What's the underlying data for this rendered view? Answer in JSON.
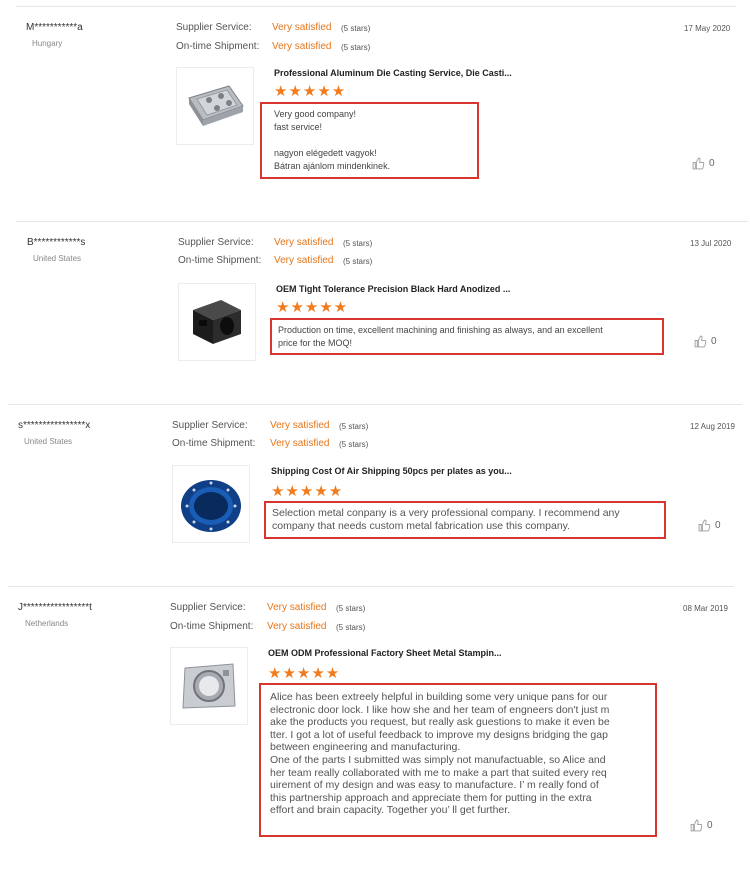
{
  "labels": {
    "supplier_service": "Supplier Service:",
    "ontime_shipment": "On-time Shipment:"
  },
  "colors": {
    "accent": "#e6761c",
    "star": "#f07c1d",
    "highlight_box": "#d9352f"
  },
  "reviews": [
    {
      "user": "M***********a",
      "country": "Hungary",
      "date": "17 May 2020",
      "supplier_value": "Very satisfied",
      "supplier_stars": "(5 stars)",
      "shipment_value": "Very satisfied",
      "shipment_stars": "(5 stars)",
      "product_title": "Professional Aluminum Die Casting Service, Die Casti...",
      "rating": "★★★★★",
      "rating_value": 5,
      "comment": "Very good company!\nfast service!\n\nnagyon elégedett vagyok!\nBátran ajánlom mindenkinek.",
      "likes": "0",
      "product_icon": "aluminum-tray-icon"
    },
    {
      "user": "B************s",
      "country": "United States",
      "date": "13 Jul 2020",
      "supplier_value": "Very satisfied",
      "supplier_stars": "(5 stars)",
      "shipment_value": "Very satisfied",
      "shipment_stars": "(5 stars)",
      "product_title": "OEM Tight Tolerance Precision Black Hard Anodized ...",
      "rating": "★★★★★",
      "rating_value": 5,
      "comment": "Production on time, excellent machining and finishing as always, and an excellent\nprice for the MOQ!",
      "likes": "0",
      "product_icon": "black-block-icon"
    },
    {
      "user": "s****************x",
      "country": "United States",
      "date": "12 Aug 2019",
      "supplier_value": "Very satisfied",
      "supplier_stars": "(5 stars)",
      "shipment_value": "Very satisfied",
      "shipment_stars": "(5 stars)",
      "product_title": "Shipping Cost Of Air Shipping 50pcs per plates as you...",
      "rating": "★★★★★",
      "rating_value": 5,
      "comment": "Selection metal conpany is a very professional company. I recommend any\ncompany that needs custom metal fabrication use this company.",
      "likes": "0",
      "product_icon": "blue-plate-icon"
    },
    {
      "user": "J*****************t",
      "country": "Netherlands",
      "date": "08 Mar 2019",
      "supplier_value": "Very satisfied",
      "supplier_stars": "(5 stars)",
      "shipment_value": "Very satisfied",
      "shipment_stars": "(5 stars)",
      "product_title": "OEM ODM Professional Factory Sheet Metal Stampin...",
      "rating": "★★★★★",
      "rating_value": 5,
      "comment": "Alice has been extreely helpful in building some very unique pans for our\nelectronic door lock. I like how she and her team of engneers don't just m\nake the products you request, but really ask guestions to make it even be\ntter. I got a lot of useful feedback to improve my designs bridging the gap\n between engineering and manufacturing.\nOne of the parts I submitted was simply not manufactuable, so Alice and\nher team really collaborated with me to make a part that suited every req\nuirement of my design and was easy to manufacture. I’   m really fond of\n this partnership approach and appreciate them for putting in the extra\n effort and brain capacity. Together you’   ll get further.",
      "likes": "0",
      "product_icon": "sheet-metal-icon"
    }
  ]
}
